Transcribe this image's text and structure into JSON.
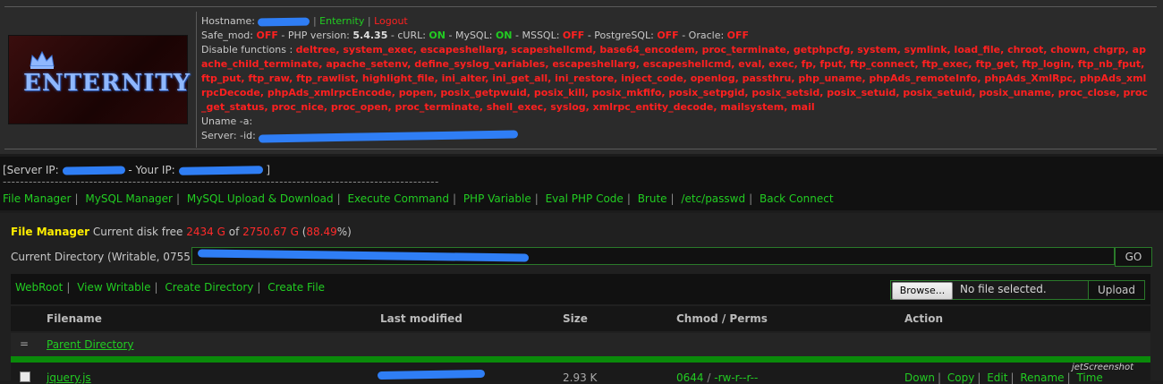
{
  "header": {
    "logo_text": "ENTERNITY",
    "hostname_label": "Hostname:",
    "enternity_link": "Enternity",
    "logout_link": "Logout",
    "safe_mod_label": "Safe_mod:",
    "safe_mod_value": "OFF",
    "php_version_label": "- PHP version:",
    "php_version_value": "5.4.35",
    "curl_label": "- cURL:",
    "curl_value": "ON",
    "mysql_label": "- MySQL:",
    "mysql_value": "ON",
    "mssql_label": "- MSSQL:",
    "mssql_value": "OFF",
    "postgresql_label": "- PostgreSQL:",
    "postgresql_value": "OFF",
    "oracle_label": "- Oracle:",
    "oracle_value": "OFF",
    "disable_functions_label": "Disable functions :",
    "disable_functions_value": "deltree, system_exec, escapeshellarg, scapeshellcmd, base64_encodem, proc_terminate, getphpcfg, system, symlink, load_file, chroot, chown, chgrp, apache_child_terminate, apache_setenv, define_syslog_variables, escapeshellarg, escapeshellcmd, eval, exec, fp, fput, ftp_connect, ftp_exec, ftp_get, ftp_login, ftp_nb_fput, ftp_put, ftp_raw, ftp_rawlist, highlight_file, ini_alter, ini_get_all, ini_restore, inject_code, openlog, passthru, php_uname, phpAds_remoteInfo, phpAds_XmlRpc, phpAds_xmlrpcDecode, phpAds_xmlrpcEncode, popen, posix_getpwuid, posix_kill, posix_mkfifo, posix_setpgid, posix_setsid, posix_setuid, posix_setuid, posix_uname, proc_close, proc_get_status, proc_nice, proc_open, proc_terminate, shell_exec, syslog, xmlrpc_entity_decode, mailsystem, mail",
    "uname_label": "Uname -a:",
    "server_label": "Server:",
    "server_id_label": "-id:"
  },
  "server_bar": {
    "server_ip_label": "[Server IP:",
    "your_ip_label": "- Your IP:",
    "close_bracket": "]",
    "dashes": "-----------------------------------------------------------------------------------------------------"
  },
  "nav": {
    "items": [
      "File Manager",
      "MySQL Manager",
      "MySQL Upload & Download",
      "Execute Command",
      "PHP Variable",
      "Eval PHP Code",
      "Brute",
      "/etc/passwd",
      "Back Connect"
    ],
    "separator": "|"
  },
  "file_manager": {
    "title": "File Manager",
    "disk_free_text": "Current disk free",
    "disk_free_value": "2434 G",
    "of_text": "of",
    "disk_total_value": "2750.67 G",
    "percent_open": "(",
    "percent_value": "88.49",
    "percent_close": "%)",
    "current_dir_label": "Current Directory (Writable, 0755)",
    "go_button": "GO",
    "toolbar_links": [
      "WebRoot",
      "View Writable",
      "Create Directory",
      "Create File"
    ],
    "browse_button": "Browse...",
    "no_file_text": "No file selected.",
    "upload_button": "Upload",
    "columns": [
      "Filename",
      "Last modified",
      "Size",
      "Chmod / Perms",
      "Action"
    ],
    "parent_dir_symbol": "=",
    "parent_dir_label": "Parent Directory",
    "files": [
      {
        "name": "jquery.js",
        "size": "2.93 K",
        "chmod": "0644",
        "perms_sep": "/",
        "perms": "-rw-r--r--",
        "actions": [
          "Down",
          "Copy",
          "Edit",
          "Rename",
          "Time"
        ]
      }
    ]
  },
  "watermark": "jetScreenshot"
}
